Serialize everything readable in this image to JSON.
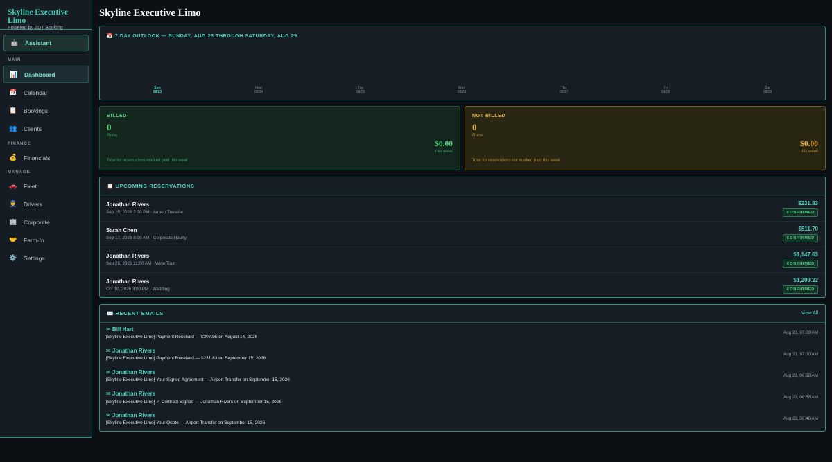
{
  "brand": {
    "title": "Skyline Executive Limo",
    "subtitle": "Powered by ZDT Booking"
  },
  "assistant": {
    "icon": "🤖",
    "label": "Assistant"
  },
  "nav": {
    "main_label": "MAIN",
    "finance_label": "FINANCE",
    "manage_label": "MANAGE",
    "items": [
      {
        "icon": "📊",
        "label": "Dashboard"
      },
      {
        "icon": "📅",
        "label": "Calendar"
      },
      {
        "icon": "📋",
        "label": "Bookings"
      },
      {
        "icon": "👥",
        "label": "Clients"
      },
      {
        "icon": "💰",
        "label": "Financials"
      },
      {
        "icon": "🚗",
        "label": "Fleet"
      },
      {
        "icon": "👮",
        "label": "Drivers"
      },
      {
        "icon": "🏢",
        "label": "Corporate"
      },
      {
        "icon": "🤝",
        "label": "Farm-In"
      },
      {
        "icon": "⚙️",
        "label": "Settings"
      }
    ]
  },
  "page": {
    "title": "Skyline Executive Limo"
  },
  "outlook": {
    "icon": "📅",
    "title": "7 DAY OUTLOOK — SUNDAY, AUG 23 THROUGH SATURDAY, AUG 29",
    "days": [
      {
        "name": "Sun",
        "date": "08/23"
      },
      {
        "name": "Mon",
        "date": "08/24"
      },
      {
        "name": "Tue",
        "date": "08/25"
      },
      {
        "name": "Wed",
        "date": "08/26"
      },
      {
        "name": "Thu",
        "date": "08/27"
      },
      {
        "name": "Fri",
        "date": "08/28"
      },
      {
        "name": "Sat",
        "date": "08/29"
      }
    ]
  },
  "billed": {
    "label": "BILLED",
    "count": "0",
    "runs": "Runs",
    "amount": "$0.00",
    "period": "this week",
    "note": "Total for reservations marked paid this week"
  },
  "not_billed": {
    "label": "NOT BILLED",
    "count": "0",
    "runs": "Runs",
    "amount": "$0.00",
    "period": "this week",
    "note": "Total for reservations not marked paid this week"
  },
  "reservations": {
    "icon": "📋",
    "title": "UPCOMING RESERVATIONS",
    "rows": [
      {
        "name": "Jonathan Rivers",
        "meta": "Sep 15, 2026 2:30 PM · Airport Transfer",
        "price": "$231.83",
        "status": "CONFIRMED"
      },
      {
        "name": "Sarah Chen",
        "meta": "Sep 17, 2026 8:00 AM · Corporate Hourly",
        "price": "$511.70",
        "status": "CONFIRMED"
      },
      {
        "name": "Jonathan Rivers",
        "meta": "Sep 26, 2026 11:00 AM · Wine Tour",
        "price": "$1,147.63",
        "status": "CONFIRMED"
      },
      {
        "name": "Jonathan Rivers",
        "meta": "Oct 10, 2026 3:00 PM · Wedding",
        "price": "$1,209.22",
        "status": "CONFIRMED"
      }
    ]
  },
  "emails": {
    "icon": "✉️",
    "title": "RECENT EMAILS",
    "view_all": "View All",
    "rows": [
      {
        "from": "✉ Bill Hart",
        "subject": "[Skyline Executive Limo] Payment Received — $307.95 on August 14, 2026",
        "time": "Aug 23, 07:08 AM"
      },
      {
        "from": "✉ Jonathan Rivers",
        "subject": "[Skyline Executive Limo] Payment Received — $231.83 on September 15, 2026",
        "time": "Aug 23, 07:00 AM"
      },
      {
        "from": "✉ Jonathan Rivers",
        "subject": "[Skyline Executive Limo] Your Signed Agreement — Airport Transfer on September 15, 2026",
        "time": "Aug 23, 06:58 AM"
      },
      {
        "from": "✉ Jonathan Rivers",
        "subject": "[Skyline Executive Limo] ✓ Contract Signed — Jonathan Rivers on September 15, 2026",
        "time": "Aug 23, 06:58 AM"
      },
      {
        "from": "✉ Jonathan Rivers",
        "subject": "[Skyline Executive Limo] Your Quote — Airport Transfer on September 15, 2026",
        "time": "Aug 23, 06:46 AM"
      }
    ]
  }
}
